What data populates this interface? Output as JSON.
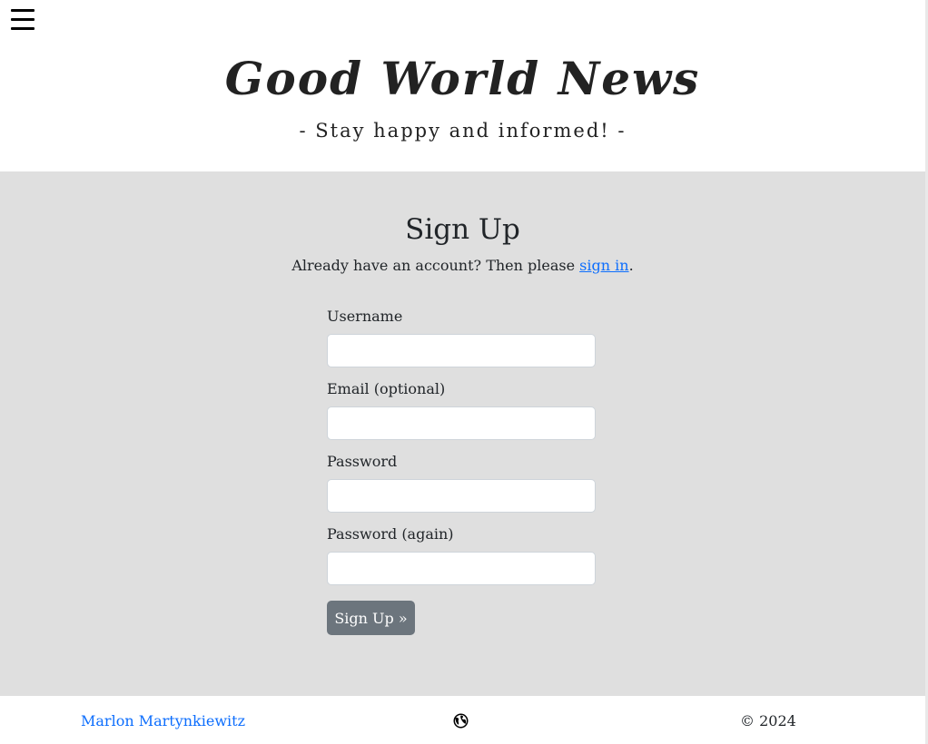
{
  "header": {
    "title": "Good World News",
    "tagline": "- Stay happy and informed! -"
  },
  "main": {
    "heading": "Sign Up",
    "signin_prefix": "Already have an account? Then please ",
    "signin_link": "sign in",
    "signin_suffix": "."
  },
  "form": {
    "fields": [
      {
        "label": "Username",
        "value": ""
      },
      {
        "label": "Email (optional)",
        "value": ""
      },
      {
        "label": "Password",
        "value": ""
      },
      {
        "label": "Password (again)",
        "value": ""
      }
    ],
    "submit_label": "Sign Up »"
  },
  "footer": {
    "author": "Marlon Martynkiewitz",
    "globe_icon": "globe-icon",
    "copyright": "© 2024"
  },
  "colors": {
    "link": "#0d6efd",
    "button": "#6c757d",
    "main_bg": "#dfdfdf"
  }
}
